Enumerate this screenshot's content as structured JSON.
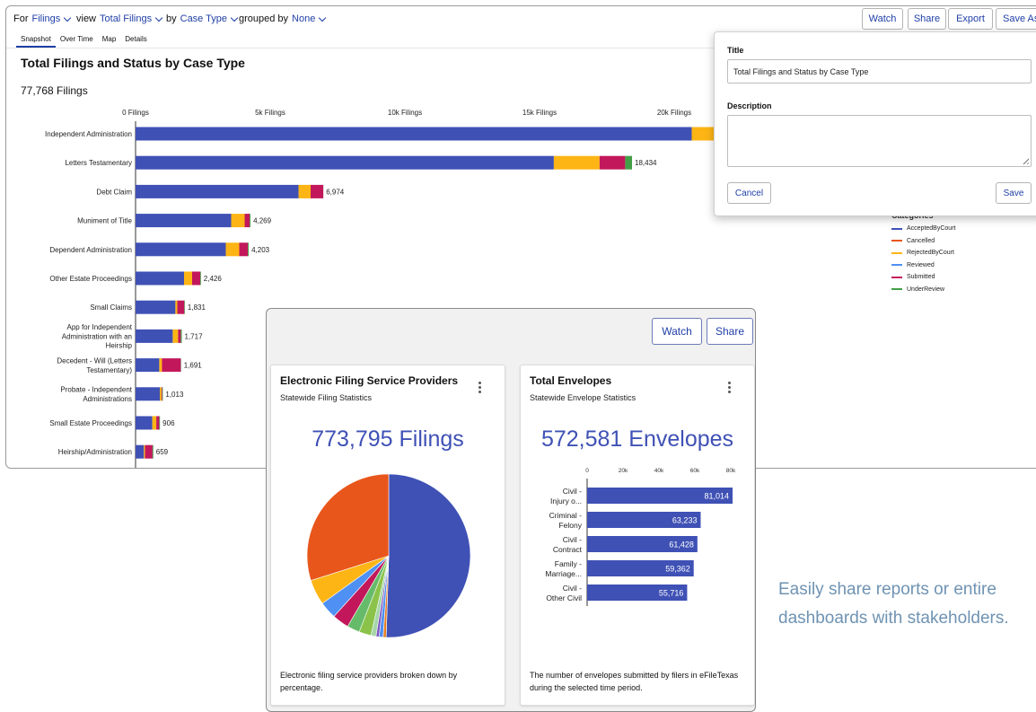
{
  "toolbar": {
    "for_label": "For",
    "for_value": "Filings",
    "view_label": "view",
    "view_value": "Total Filings",
    "by_label": "by",
    "by_value": "Case Type",
    "grouped_label": "grouped by",
    "grouped_value": "None",
    "buttons": [
      "Watch",
      "Share",
      "Export",
      "Save As"
    ]
  },
  "tabs": [
    "Snapshot",
    "Over Time",
    "Map",
    "Details"
  ],
  "active_tab": "Snapshot",
  "report": {
    "title": "Total Filings and Status by Case Type",
    "total": "77,768 Filings"
  },
  "dialog": {
    "title_label": "Title",
    "title_value": "Total Filings and Status by Case Type",
    "description_label": "Description",
    "description_value": "",
    "cancel_label": "Cancel",
    "save_label": "Save"
  },
  "legend": {
    "title": "Categories",
    "items": [
      {
        "label": "AcceptedByCourt",
        "color": "#3f51b5"
      },
      {
        "label": "Cancelled",
        "color": "#e8561b"
      },
      {
        "label": "RejectedByCourt",
        "color": "#fdb515"
      },
      {
        "label": "Reviewed",
        "color": "#4e90f3"
      },
      {
        "label": "Submitted",
        "color": "#c2185b"
      },
      {
        "label": "UnderReview",
        "color": "#43a047"
      }
    ]
  },
  "chart_data": [
    {
      "type": "bar",
      "orientation": "horizontal",
      "stacked": true,
      "title": "Total Filings and Status by Case Type",
      "x_ticks": [
        "0 Filings",
        "5k Filings",
        "10k Filings",
        "15k Filings",
        "20k Filings"
      ],
      "xlim": [
        0,
        22000
      ],
      "categories": [
        "Independent Administration",
        "Letters Testamentary",
        "Debt Claim",
        "Muniment of Title",
        "Dependent Administration",
        "Other Estate Proceedings",
        "Small Claims",
        "App for Independent Administration with an Heirship",
        "Decedent - Will (Letters Testamentary)",
        "Probate - Independent Administrations",
        "Small Estate Proceedings",
        "Heirship/Administration"
      ],
      "category_lines": [
        [
          "Independent Administration"
        ],
        [
          "Letters Testamentary"
        ],
        [
          "Debt Claim"
        ],
        [
          "Muniment of Title"
        ],
        [
          "Dependent Administration"
        ],
        [
          "Other Estate Proceedings"
        ],
        [
          "Small Claims"
        ],
        [
          "App for Independent",
          "Administration with an",
          "Heirship"
        ],
        [
          "Decedent - Will (Letters",
          "Testamentary)"
        ],
        [
          "Probate - Independent",
          "Administrations"
        ],
        [
          "Small Estate Proceedings"
        ],
        [
          "Heirship/Administration"
        ]
      ],
      "totals": [
        null,
        "18,434",
        "6,974",
        "4,269",
        "4,203",
        "2,426",
        "1,831",
        "1,717",
        "1,691",
        "1,013",
        "906",
        "659"
      ],
      "series": [
        {
          "name": "AcceptedByCourt",
          "color": "#3f51b5",
          "values": [
            20650,
            15530,
            6050,
            3550,
            3350,
            1800,
            1480,
            1380,
            880,
            900,
            620,
            310
          ]
        },
        {
          "name": "RejectedByCourt",
          "color": "#fdb515",
          "values": [
            1500,
            1700,
            450,
            500,
            500,
            300,
            70,
            200,
            100,
            60,
            150,
            40
          ]
        },
        {
          "name": "Submitted",
          "color": "#c2185b",
          "values": [
            0,
            950,
            470,
            190,
            320,
            300,
            260,
            100,
            700,
            30,
            110,
            280
          ]
        },
        {
          "name": "UnderReview",
          "color": "#43a047",
          "values": [
            0,
            254,
            4,
            29,
            33,
            26,
            21,
            37,
            11,
            23,
            26,
            29
          ]
        }
      ]
    },
    {
      "type": "pie",
      "title": "Electronic Filing Service Providers",
      "subtitle": "Statewide Filing Statistics",
      "slices": [
        {
          "color": "#3f51b5",
          "percent": 50.5
        },
        {
          "color": "#e67e22",
          "percent": 0.6
        },
        {
          "color": "#4e90f3",
          "percent": 0.8
        },
        {
          "color": "#7e57c2",
          "percent": 0.6
        },
        {
          "color": "#a5d6a7",
          "percent": 1.0
        },
        {
          "color": "#8bc34a",
          "percent": 2.4
        },
        {
          "color": "#66bb6a",
          "percent": 2.5
        },
        {
          "color": "#c2185b",
          "percent": 3.3
        },
        {
          "color": "#4e90f3",
          "percent": 3.4
        },
        {
          "color": "#fdb515",
          "percent": 5.0
        },
        {
          "color": "#e8561b",
          "percent": 29.9
        }
      ]
    },
    {
      "type": "bar",
      "orientation": "horizontal",
      "title": "Total Envelopes",
      "subtitle": "Statewide Envelope Statistics",
      "x_ticks": [
        "0",
        "20k",
        "40k",
        "60k",
        "80k"
      ],
      "xlim": [
        0,
        80000
      ],
      "category_lines": [
        [
          "Civil -",
          "Injury o..."
        ],
        [
          "Criminal -",
          "Felony"
        ],
        [
          "Civil -",
          "Contract"
        ],
        [
          "Family -",
          "Marriage..."
        ],
        [
          "Civil -",
          "Other Civil"
        ]
      ],
      "values": [
        81014,
        63233,
        61428,
        59362,
        55716
      ],
      "value_labels": [
        "81,014",
        "63,233",
        "61,428",
        "59,362",
        "55,716"
      ],
      "color": "#3f51b5"
    }
  ],
  "dashboard": {
    "watch_label": "Watch",
    "share_label": "Share",
    "card1": {
      "title": "Electronic Filing Service Providers",
      "subtitle": "Statewide Filing Statistics",
      "big_number": "773,795 Filings",
      "description": "Electronic filing service providers broken down by percentage."
    },
    "card2": {
      "title": "Total Envelopes",
      "subtitle": "Statewide Envelope Statistics",
      "big_number": "572,581 Envelopes",
      "description": "The number of envelopes submitted by filers in eFileTexas during the selected time period."
    }
  },
  "tagline": "Easily share reports or entire dashboards with stakeholders."
}
